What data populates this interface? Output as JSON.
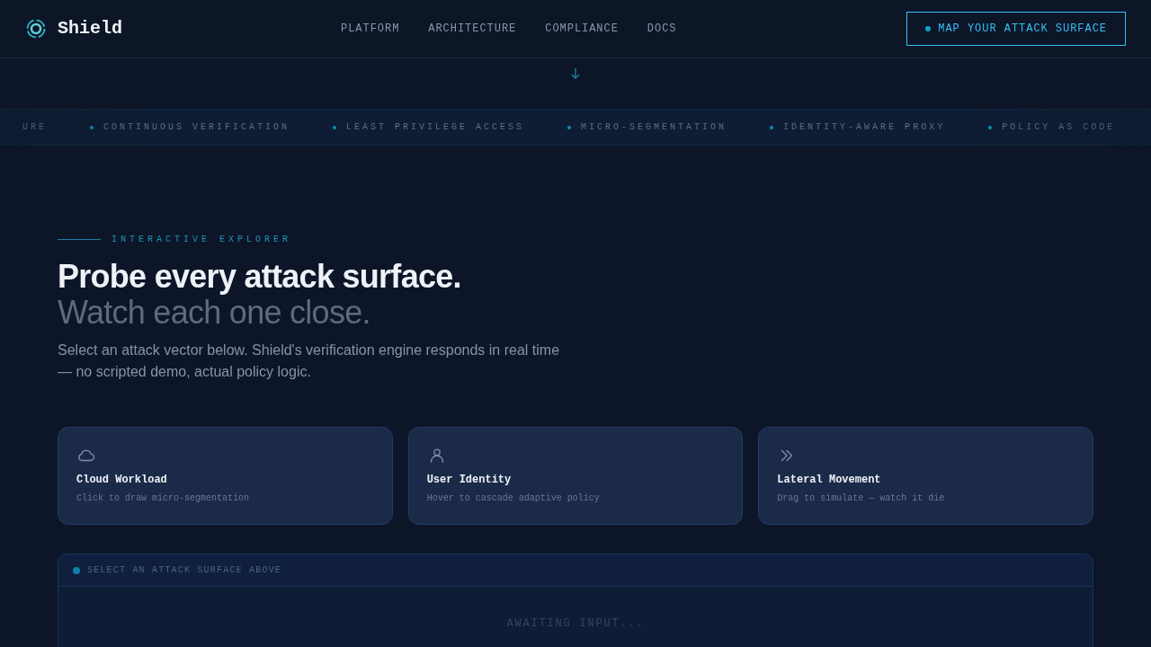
{
  "brand": "Shield",
  "nav": [
    "PLATFORM",
    "ARCHITECTURE",
    "COMPLIANCE",
    "DOCS"
  ],
  "cta": "MAP YOUR ATTACK SURFACE",
  "ticker": [
    "URE",
    "CONTINUOUS VERIFICATION",
    "LEAST PRIVILEGE ACCESS",
    "MICRO-SEGMENTATION",
    "IDENTITY-AWARE PROXY",
    "POLICY AS CODE"
  ],
  "eyebrow": "INTERACTIVE EXPLORER",
  "heading": "Probe every attack surface.",
  "subheading": "Watch each one close.",
  "intro": "Select an attack vector below. Shield's verification engine responds in real time — no scripted demo, actual policy logic.",
  "cards": [
    {
      "kind": "cloud",
      "title": "Cloud Workload",
      "hint": "Click to draw micro-segmentation"
    },
    {
      "kind": "user",
      "title": "User Identity",
      "hint": "Hover to cascade adaptive policy"
    },
    {
      "kind": "chevrons",
      "title": "Lateral Movement",
      "hint": "Drag to simulate — watch it die"
    }
  ],
  "panel": {
    "status": "SELECT AN ATTACK SURFACE ABOVE",
    "message": "AWAITING INPUT..."
  }
}
